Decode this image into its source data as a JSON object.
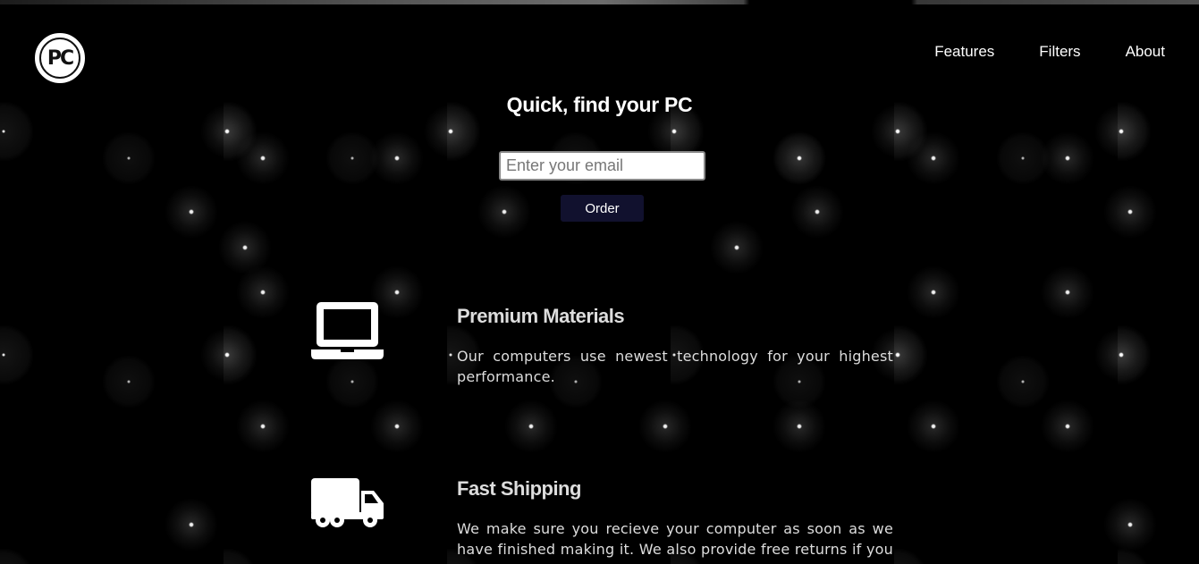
{
  "nav": {
    "logo_text": "PC",
    "items": [
      {
        "label": "Features"
      },
      {
        "label": "Filters"
      },
      {
        "label": "About"
      }
    ]
  },
  "hero": {
    "title": "Quick, find your PC",
    "email_placeholder": "Enter your email",
    "order_label": "Order"
  },
  "features": [
    {
      "icon": "laptop-icon",
      "title": "Premium Materials",
      "description": "Our computers use newest technology for your highest performance."
    },
    {
      "icon": "truck-icon",
      "title": "Fast Shipping",
      "description": "We make sure you recieve your computer as soon as we have finished making it. We also provide free returns if you are not"
    }
  ]
}
